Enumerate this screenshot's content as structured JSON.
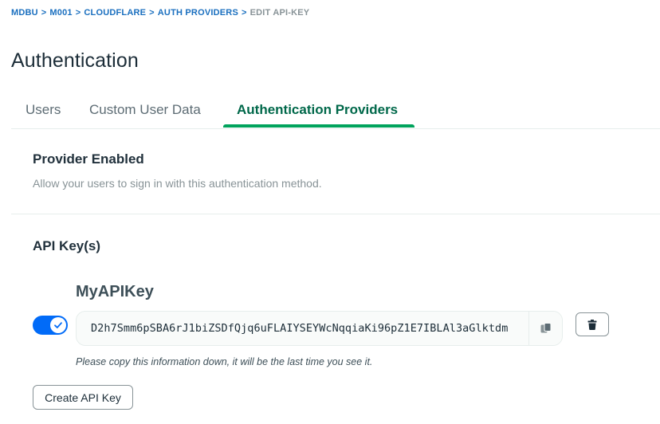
{
  "breadcrumb": {
    "items": [
      "MDBU",
      "M001",
      "CLOUDFLARE",
      "AUTH PROVIDERS"
    ],
    "separator": ">",
    "current": "EDIT API-KEY"
  },
  "page": {
    "title": "Authentication"
  },
  "tabs": [
    {
      "label": "Users",
      "active": false
    },
    {
      "label": "Custom User Data",
      "active": false
    },
    {
      "label": "Authentication Providers",
      "active": true
    }
  ],
  "provider": {
    "title": "Provider Enabled",
    "description": "Allow your users to sign in with this authentication method."
  },
  "api_keys": {
    "title": "API Key(s)",
    "key": {
      "name": "MyAPIKey",
      "enabled": true,
      "value": "D2h7Smm6pSBA6rJ1biZSDfQjq6uFLAIYSEYWcNqqiaKi96pZ1E7IBLAl3aGlktdm",
      "copy_icon": "copy-icon",
      "delete_icon": "trash-icon"
    },
    "note": "Please copy this information down, it will be the last time you see it.",
    "create_label": "Create API Key"
  },
  "colors": {
    "link": "#1a6fbf",
    "active_tab": "#00684a",
    "tab_underline": "#00a35c",
    "toggle_on": "#016bf8"
  }
}
